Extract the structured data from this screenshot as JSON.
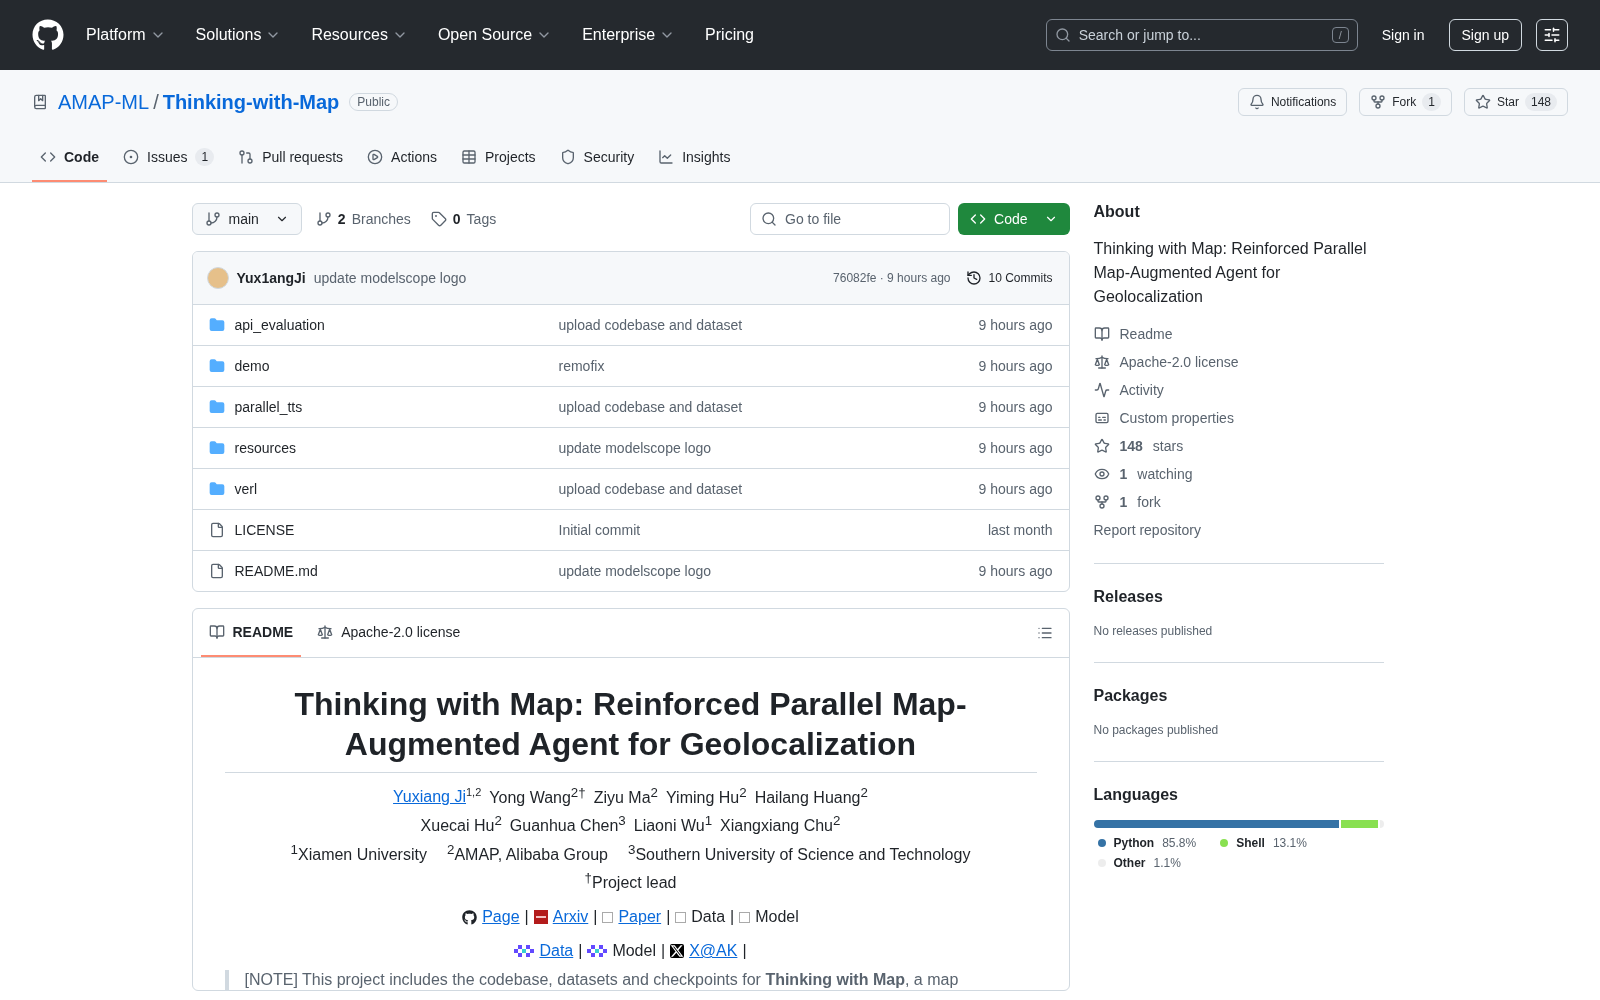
{
  "header": {
    "nav": [
      {
        "label": "Platform",
        "dropdown": true
      },
      {
        "label": "Solutions",
        "dropdown": true
      },
      {
        "label": "Resources",
        "dropdown": true
      },
      {
        "label": "Open Source",
        "dropdown": true
      },
      {
        "label": "Enterprise",
        "dropdown": true
      },
      {
        "label": "Pricing",
        "dropdown": false
      }
    ],
    "search": {
      "placeholder": "Search or jump to...",
      "shortcut": "/"
    },
    "sign_in": "Sign in",
    "sign_up": "Sign up"
  },
  "repo": {
    "owner": "AMAP-ML",
    "separator": "/",
    "name": "Thinking-with-Map",
    "visibility": "Public",
    "actions": [
      {
        "kind": "notifications",
        "label": "Notifications"
      },
      {
        "kind": "fork",
        "label": "Fork",
        "count": "1"
      },
      {
        "kind": "star",
        "label": "Star",
        "count": "148"
      }
    ],
    "tabs": [
      {
        "kind": "code",
        "label": "Code",
        "selected": true
      },
      {
        "kind": "issues",
        "label": "Issues",
        "count": "1",
        "selected": false
      },
      {
        "kind": "pulls",
        "label": "Pull requests",
        "selected": false
      },
      {
        "kind": "actions",
        "label": "Actions",
        "selected": false
      },
      {
        "kind": "projects",
        "label": "Projects",
        "selected": false
      },
      {
        "kind": "security",
        "label": "Security",
        "selected": false
      },
      {
        "kind": "insights",
        "label": "Insights",
        "selected": false
      }
    ]
  },
  "toolbar": {
    "branch": "main",
    "branches_count": "2",
    "branches_label": "Branches",
    "tags_count": "0",
    "tags_label": "Tags",
    "go_to_file": "Go to file",
    "code_button": "Code"
  },
  "commit": {
    "author": "Yux1angJi",
    "message": "update modelscope logo",
    "hash_time": "76082fe · 9 hours ago",
    "commits": "10 Commits"
  },
  "files": [
    {
      "kind": "folder",
      "name": "api_evaluation",
      "message": "upload codebase and dataset",
      "time": "9 hours ago"
    },
    {
      "kind": "folder",
      "name": "demo",
      "message": "remofix",
      "time": "9 hours ago"
    },
    {
      "kind": "folder",
      "name": "parallel_tts",
      "message": "upload codebase and dataset",
      "time": "9 hours ago"
    },
    {
      "kind": "folder",
      "name": "resources",
      "message": "update modelscope logo",
      "time": "9 hours ago"
    },
    {
      "kind": "folder",
      "name": "verl",
      "message": "upload codebase and dataset",
      "time": "9 hours ago"
    },
    {
      "kind": "file",
      "name": "LICENSE",
      "message": "Initial commit",
      "time": "last month"
    },
    {
      "kind": "file",
      "name": "README.md",
      "message": "update modelscope logo",
      "time": "9 hours ago"
    }
  ],
  "readme": {
    "tabs": [
      {
        "kind": "readme",
        "label": "README",
        "selected": true
      },
      {
        "kind": "license",
        "label": "Apache-2.0 license",
        "selected": false
      }
    ],
    "title": "Thinking with Map: Reinforced Parallel Map-Augmented Agent for Geolocalization",
    "author_lines": [
      [
        {
          "name": "Yuxiang Ji",
          "sup": "1,2",
          "link": true
        },
        {
          "name": "Yong Wang",
          "sup": "2†",
          "link": false
        },
        {
          "name": "Ziyu Ma",
          "sup": "2",
          "link": false
        },
        {
          "name": "Yiming Hu",
          "sup": "2",
          "link": false
        },
        {
          "name": "Hailang Huang",
          "sup": "2",
          "link": false
        }
      ],
      [
        {
          "name": "Xuecai Hu",
          "sup": "2",
          "link": false
        },
        {
          "name": "Guanhua Chen",
          "sup": "3",
          "link": false
        },
        {
          "name": "Liaoni Wu",
          "sup": "1",
          "link": false
        },
        {
          "name": "Xiangxiang Chu",
          "sup": "2",
          "link": false
        }
      ]
    ],
    "affiliations": [
      "$^{1}$Xiamen University",
      "$^{2}$AMAP, Alibaba Group",
      "$^{3}$Southern University of Science and Technology"
    ],
    "note": "$^{†}$Project lead",
    "link_rows": [
      [
        {
          "kind": "page",
          "text": "Page"
        },
        {
          "kind": "separator",
          "text": "|"
        },
        {
          "kind": "arxiv",
          "text": "Arxiv"
        },
        {
          "kind": "separator",
          "text": "|"
        },
        {
          "kind": "paper",
          "text": "Paper"
        },
        {
          "kind": "separator",
          "text": "|"
        },
        {
          "kind": "hfdata",
          "text": "Data"
        },
        {
          "kind": "separator",
          "text": "|"
        },
        {
          "kind": "hfmodel",
          "text": "Model"
        }
      ],
      [
        {
          "kind": "msdata",
          "text": "Data"
        },
        {
          "kind": "separator",
          "text": "|"
        },
        {
          "kind": "msmodel",
          "text": "Model"
        },
        {
          "kind": "separator",
          "text": "|"
        },
        {
          "kind": "twitter",
          "text": "X@AK"
        },
        {
          "kind": "separator",
          "text": "|"
        }
      ]
    ],
    "quote": "[NOTE] This project includes the codebase, datasets and checkpoints for **Thinking with Map**, a map"
  },
  "about": {
    "heading": "About",
    "description": "Thinking with Map: Reinforced Parallel Map-Augmented Agent for Geolocalization",
    "links": [
      {
        "kind": "readme",
        "label": "Readme"
      },
      {
        "kind": "license",
        "label": "Apache-2.0 license"
      },
      {
        "kind": "activity",
        "label": "Activity"
      },
      {
        "kind": "properties",
        "label": "Custom properties"
      },
      {
        "kind": "stars",
        "count": "148",
        "label": "stars"
      },
      {
        "kind": "watching",
        "count": "1",
        "label": "watching"
      },
      {
        "kind": "fork",
        "count": "1",
        "label": "fork"
      }
    ],
    "report": "Report repository"
  },
  "releases": {
    "heading": "Releases",
    "text": "No releases published"
  },
  "packages": {
    "heading": "Packages",
    "text": "No packages published"
  },
  "languages": {
    "heading": "Languages",
    "items": [
      {
        "name": "Python",
        "percent": "85.8%",
        "color": "#3572a5"
      },
      {
        "name": "Shell",
        "percent": "13.1%",
        "color": "#89e051"
      },
      {
        "name": "Other",
        "percent": "1.1%",
        "color": "#ededed"
      }
    ]
  }
}
